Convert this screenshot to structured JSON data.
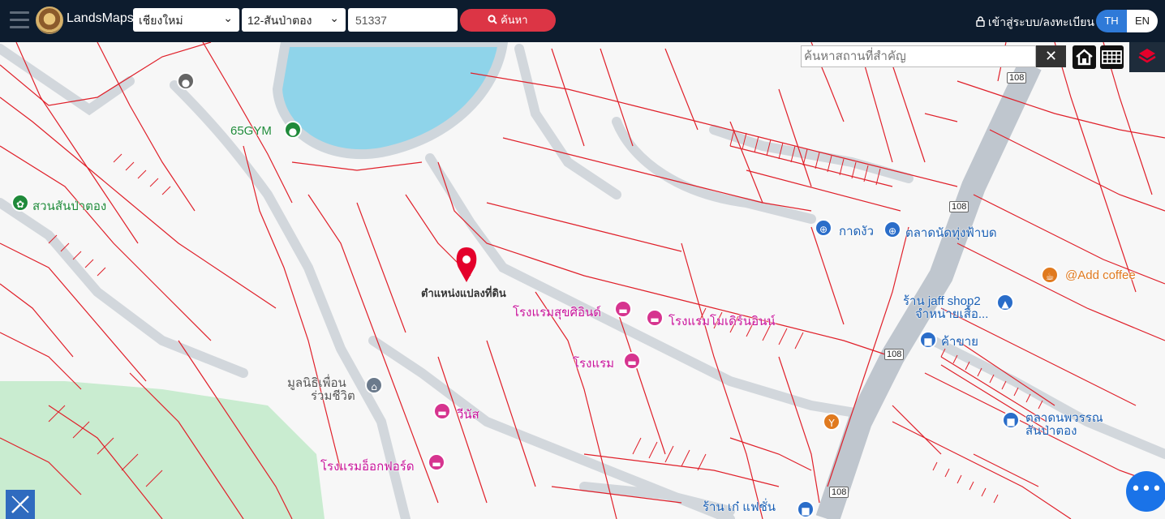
{
  "header": {
    "brand": "LandsMaps",
    "province": "เชียงใหม่",
    "district": "12-สันป่าตอง",
    "parcel_number": "51337",
    "search_label": "ค้นหา",
    "login_label": "เข้าสู่ระบบ/ลงทะเบียน",
    "lang_th": "TH",
    "lang_en": "EN"
  },
  "map_search": {
    "placeholder": "ค้นหาสถานที่สำคัญ",
    "clear_label": "✕"
  },
  "map": {
    "parcel_marker_label": "ตำแหน่งแปลงที่ดิน",
    "pois": [
      {
        "name": "65GYM",
        "type": "gym"
      },
      {
        "name": "สวนสันป่าตอง",
        "type": "park"
      },
      {
        "name": "กาดงัว",
        "type": "shop"
      },
      {
        "name": "ตลาดนัดทุ่งฟ้าบด",
        "type": "shop"
      },
      {
        "name": "@Add coffee",
        "type": "cafe"
      },
      {
        "name": "ร้าน jaff shop2",
        "type": "shop"
      },
      {
        "name": "จำหน่ายเสื้อ...",
        "type": "shop"
      },
      {
        "name": "ค้าขาย",
        "type": "shop"
      },
      {
        "name": "โรงแรมสุขศิอินด์",
        "type": "hotel"
      },
      {
        "name": "โรงแรมโมเดิร์นอินน์",
        "type": "hotel"
      },
      {
        "name": "โรงแรม",
        "type": "hotel"
      },
      {
        "name": "มูลนิธิเพื่อน",
        "type": "foundation"
      },
      {
        "name": "ร่วมชีวิต",
        "type": "foundation"
      },
      {
        "name": "วีนัส",
        "type": "hotel"
      },
      {
        "name": "โรงแรมอ็อกฟอร์ด",
        "type": "hotel"
      },
      {
        "name": "ตลาดนพวรรณ",
        "type": "shop"
      },
      {
        "name": "สันป่าตอง",
        "type": "shop"
      },
      {
        "name": "ร้าน เก๋ แฟชั่น",
        "type": "shop"
      }
    ],
    "road_shields": [
      "108",
      "108",
      "108",
      "108"
    ]
  }
}
